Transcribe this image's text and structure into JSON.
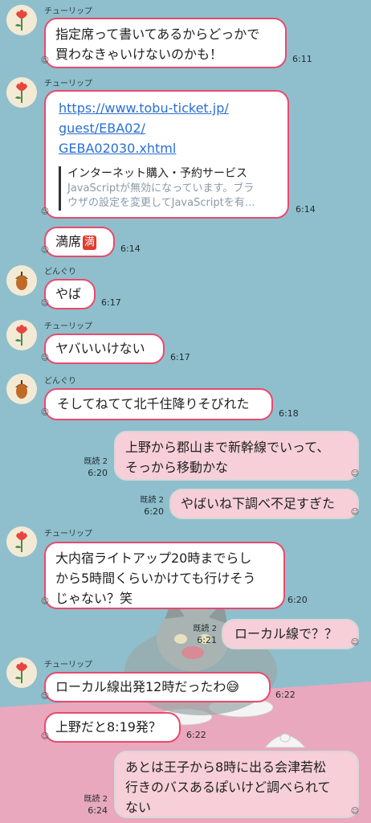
{
  "messages": {
    "m1": {
      "sender": "チューリップ",
      "line1": "指定席って書いてあるからどっかで",
      "line2": "買わなきゃいけないのかも！",
      "time": "6:11"
    },
    "m2": {
      "sender": "チューリップ",
      "url1": "https://www.tobu-ticket.jp/",
      "url2": "guest/EBA02/",
      "url3": "GEBA02030.xhtml",
      "preview_title": "インターネット購入・予約サービス",
      "preview_desc1": "JavaScriptが無効になっています。ブラ",
      "preview_desc2": "ウザの設定を変更してJavaScriptを有…",
      "time": "6:14"
    },
    "m3": {
      "text": "満席",
      "badge": "満",
      "time": "6:14"
    },
    "m4": {
      "sender": "どんぐり",
      "text": "やば",
      "time": "6:17"
    },
    "m5": {
      "sender": "チューリップ",
      "text": "ヤバいいけない",
      "time": "6:17"
    },
    "m6": {
      "sender": "どんぐり",
      "text": "そしてねてて北千住降りそびれた",
      "time": "6:18"
    },
    "m7": {
      "read": "既読 2",
      "time": "6:20",
      "line1": "上野から郡山まで新幹線でいって、",
      "line2": "そっから移動かな"
    },
    "m8": {
      "read": "既読 2",
      "time": "6:20",
      "text": "やばいね下調べ不足すぎた"
    },
    "m9": {
      "sender": "チューリップ",
      "line1": "大内宿ライトアップ20時までらし",
      "line2": "から5時間くらいかけても行けそう",
      "line3": "じゃない？笑",
      "time": "6:20"
    },
    "m10": {
      "read": "既読 2",
      "time": "6:21",
      "text": "ローカル線で？？"
    },
    "m11": {
      "sender": "チューリップ",
      "text": "ローカル線出発12時だったわ😅",
      "time": "6:22"
    },
    "m12": {
      "text": "上野だと8:19発？",
      "time": "6:22"
    },
    "m13": {
      "read": "既読 2",
      "time": "6:24",
      "line1": "あとは王子から8時に出る会津若松",
      "line2": "行きのバスあるぽいけど調べられて",
      "line3": "ない"
    }
  },
  "colors": {
    "background": "#8fbfcc",
    "bubble_border": "#e84a6e",
    "my_bubble": "#f6cfd9",
    "link": "#2a6fd6"
  },
  "icons": {
    "tulip_avatar": "tulip-icon",
    "acorn_avatar": "acorn-icon"
  }
}
